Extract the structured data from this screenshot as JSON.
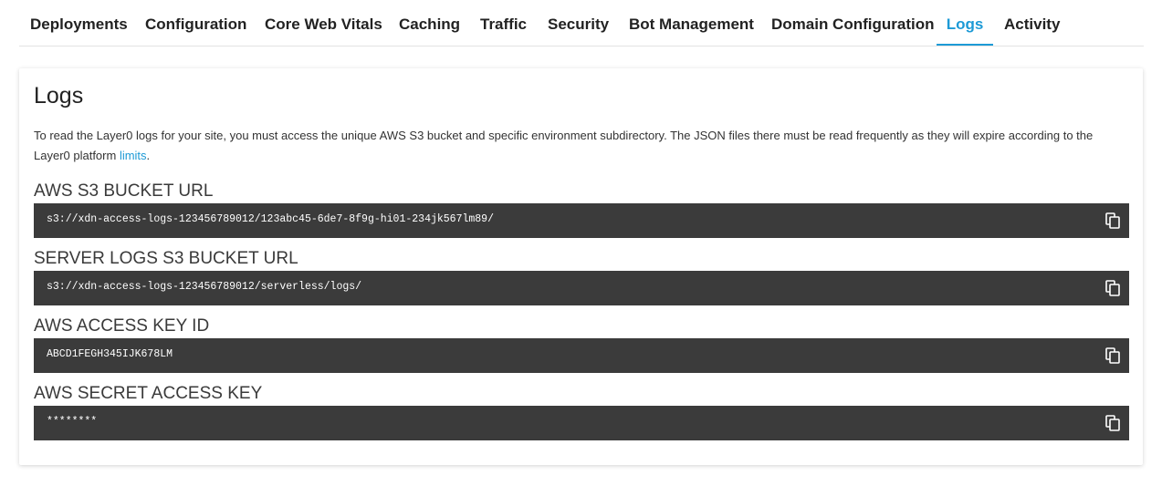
{
  "tabs": [
    {
      "label": "Deployments"
    },
    {
      "label": "Configuration"
    },
    {
      "label": "Core Web Vitals"
    },
    {
      "label": "Caching"
    },
    {
      "label": "Traffic"
    },
    {
      "label": "Security"
    },
    {
      "label": "Bot Management"
    },
    {
      "label": "Domain Configuration"
    },
    {
      "label": "Logs",
      "active": true
    },
    {
      "label": "Activity"
    }
  ],
  "colors": {
    "accent": "#1d9ad6",
    "code_background": "#3b3b3b"
  },
  "logs": {
    "title": "Logs",
    "description_prefix": "To read the Layer0 logs for your site, you must access the unique AWS S3 bucket and specific environment subdirectory. The JSON files there must be read frequently as they will expire according to the Layer0 platform ",
    "description_link": "limits",
    "description_suffix": ".",
    "fields": [
      {
        "label": "AWS S3 BUCKET URL",
        "value": "s3://xdn-access-logs-123456789012/123abc45-6de7-8f9g-hi01-234jk567lm89/",
        "icon": "copy-icon"
      },
      {
        "label": "SERVER LOGS S3 BUCKET URL",
        "value": "s3://xdn-access-logs-123456789012/serverless/logs/",
        "icon": "copy-icon"
      },
      {
        "label": "AWS ACCESS KEY ID",
        "value": "ABCD1FEGH345IJK678LM",
        "icon": "copy-icon"
      },
      {
        "label": "AWS SECRET ACCESS KEY",
        "value": "********",
        "icon": "copy-icon"
      }
    ]
  }
}
